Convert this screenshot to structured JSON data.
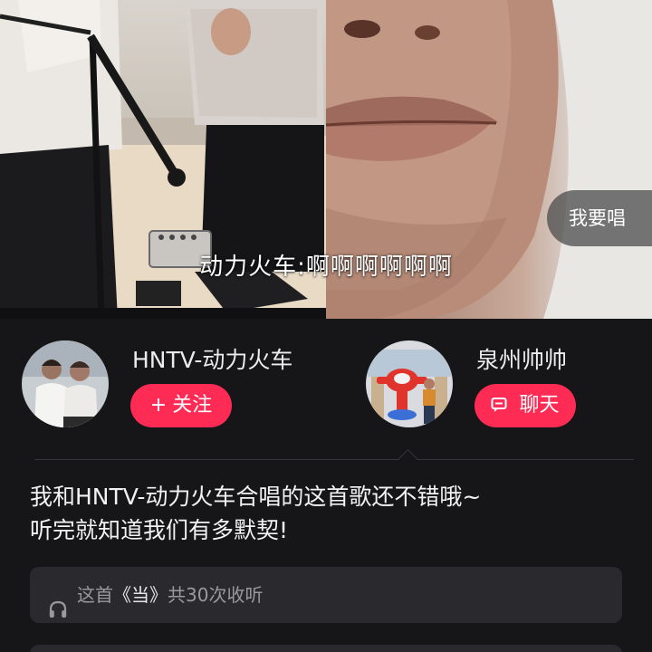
{
  "video": {
    "lyric": "动力火车:啊啊啊啊啊啊",
    "sing_button_label": "我要唱"
  },
  "duet": {
    "left_user": {
      "name": "HNTV-动力火车",
      "action_icon": "plus-icon",
      "action_glyph": "+",
      "action_label": "关注"
    },
    "right_user": {
      "name": "泉州帅帅",
      "action_icon": "chat-icon",
      "action_label": "聊天"
    }
  },
  "description": {
    "line1": "我和HNTV-动力火车合唱的这首歌还不错哦~",
    "line2": "听完就知道我们有多默契!"
  },
  "song": {
    "icon": "headphones-icon",
    "prefix": "这首",
    "title": "《当》",
    "suffix": "共30次收听"
  },
  "colors": {
    "background": "#161618",
    "accent": "#fe2c55",
    "card": "#2a2a2e",
    "muted_text": "#9a9a9e"
  }
}
